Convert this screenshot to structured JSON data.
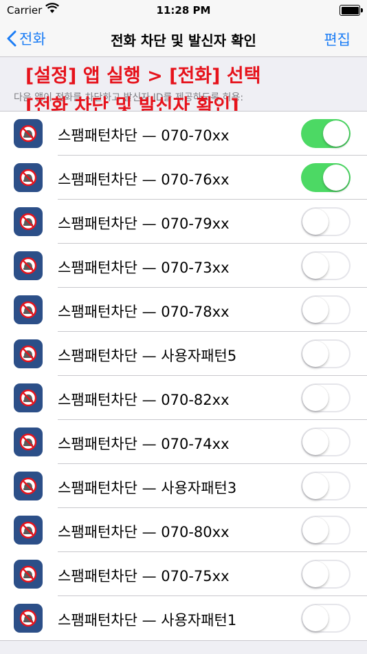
{
  "status_bar": {
    "carrier": "Carrier",
    "time": "11:28 PM"
  },
  "nav": {
    "back_label": "전화",
    "title": "전화 차단 및 발신자 확인",
    "edit_label": "편집"
  },
  "caption": "다음 앱이 전화를 차단하고 발신자 ID를 제공하도록 허용:",
  "overlay": {
    "line1": "[설정] 앱 실행 > [전화] 선택",
    "line2": "[전화 차단 및 발신자 확인]"
  },
  "colors": {
    "accent": "#1a7cf5",
    "toggle_on": "#4cd964",
    "overlay_text": "#e6121b",
    "app_icon_bg": "#2c4f88"
  },
  "icons": {
    "back": "chevron-left-icon",
    "app": "spam-block-phone-icon"
  },
  "items": [
    {
      "label": "스팸패턴차단 — 070-70xx",
      "enabled": true
    },
    {
      "label": "스팸패턴차단 — 070-76xx",
      "enabled": true
    },
    {
      "label": "스팸패턴차단 — 070-79xx",
      "enabled": false
    },
    {
      "label": "스팸패턴차단 — 070-73xx",
      "enabled": false
    },
    {
      "label": "스팸패턴차단 — 070-78xx",
      "enabled": false
    },
    {
      "label": "스팸패턴차단 — 사용자패턴5",
      "enabled": false
    },
    {
      "label": "스팸패턴차단 — 070-82xx",
      "enabled": false
    },
    {
      "label": "스팸패턴차단 — 070-74xx",
      "enabled": false
    },
    {
      "label": "스팸패턴차단 — 사용자패턴3",
      "enabled": false
    },
    {
      "label": "스팸패턴차단 — 070-80xx",
      "enabled": false
    },
    {
      "label": "스팸패턴차단 — 070-75xx",
      "enabled": false
    },
    {
      "label": "스팸패턴차단 — 사용자패턴1",
      "enabled": false
    }
  ]
}
